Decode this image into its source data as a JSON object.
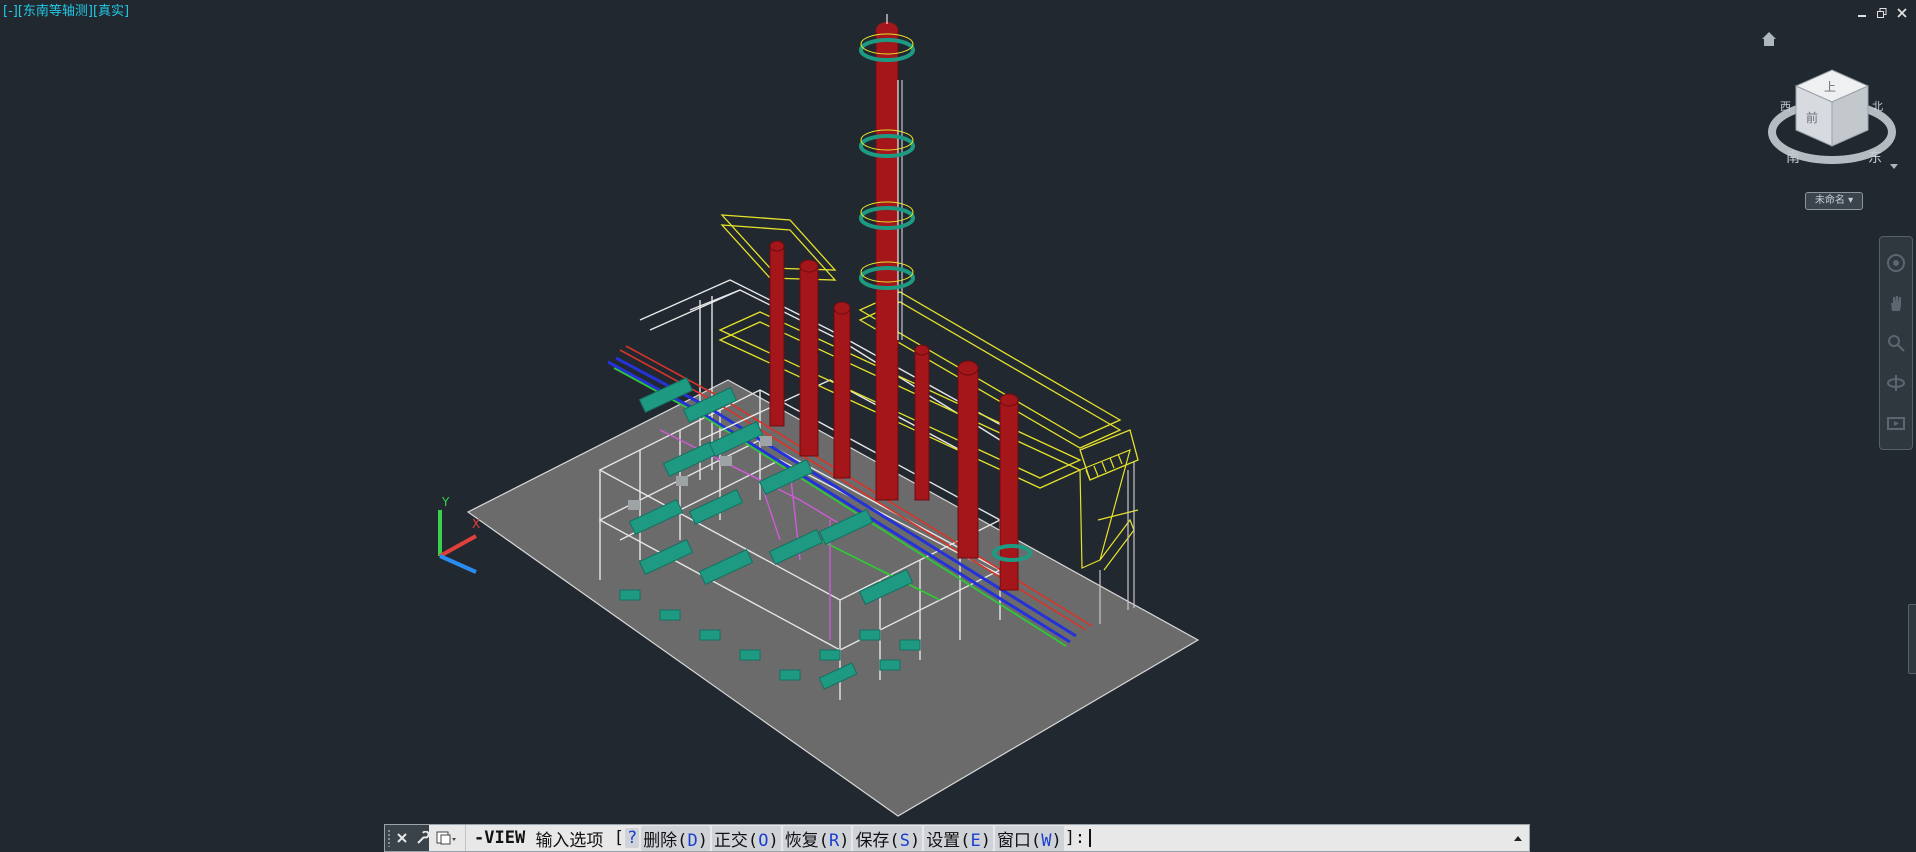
{
  "viewport": {
    "label": "[-][东南等轴测][真实]",
    "window_controls": [
      "minimize-icon",
      "restore-icon",
      "close-icon"
    ]
  },
  "viewcube": {
    "faces": {
      "top": "上",
      "front": "前"
    },
    "compass": {
      "north": "北",
      "south": "南",
      "east": "东",
      "west": "西"
    },
    "wcs_label": "未命名"
  },
  "ucs": {
    "y_label": "Y",
    "x_label": "X"
  },
  "command_line": {
    "command": "-VIEW",
    "prompt": "输入选项",
    "open_bracket": "[",
    "options": [
      {
        "text": "?",
        "key": ""
      },
      {
        "text": "删除(",
        "key": "D",
        "close": ")"
      },
      {
        "text": "正交(",
        "key": "O",
        "close": ")"
      },
      {
        "text": "恢复(",
        "key": "R",
        "close": ")"
      },
      {
        "text": "保存(",
        "key": "S",
        "close": ")"
      },
      {
        "text": "设置(",
        "key": "E",
        "close": ")"
      },
      {
        "text": "窗口(",
        "key": "W",
        "close": ")"
      }
    ],
    "suffix": "]:"
  },
  "colors": {
    "background": "#212830",
    "ground": "#6b6b6b",
    "vessel": "#a4161a",
    "platform": "#e6e22a",
    "equipment": "#1f9a82",
    "pipe_white": "#e8e8e8",
    "pipe_blue": "#2432d8",
    "pipe_magenta": "#d05ad8",
    "pipe_green": "#2fc83a"
  }
}
